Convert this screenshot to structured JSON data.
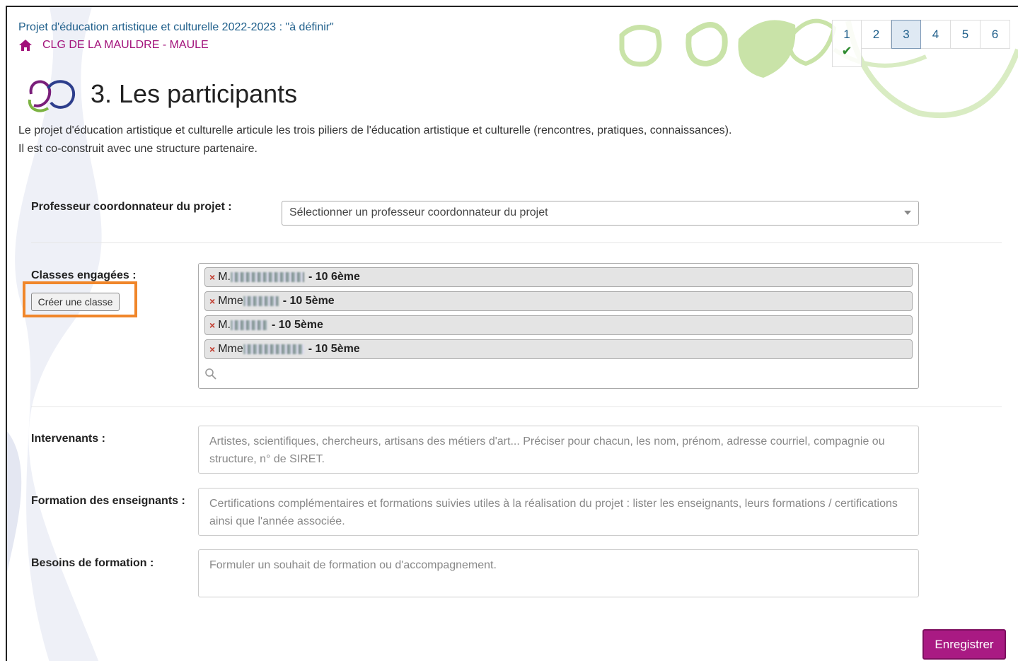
{
  "header": {
    "project_title": "Projet d'éducation artistique et culturelle 2022-2023 : \"à définir\"",
    "school": "CLG DE LA MAULDRE - MAULE"
  },
  "steps": [
    {
      "label": "1",
      "done": true
    },
    {
      "label": "2"
    },
    {
      "label": "3",
      "active": true
    },
    {
      "label": "4"
    },
    {
      "label": "5"
    },
    {
      "label": "6"
    }
  ],
  "page": {
    "title": "3. Les participants",
    "intro_line1": "Le projet d'éducation artistique et culturelle articule les trois piliers de l'éducation artistique et culturelle (rencontres, pratiques, connaissances).",
    "intro_line2": "Il est co-construit avec une structure partenaire."
  },
  "form": {
    "coordinator_label": "Professeur coordonnateur du projet :",
    "coordinator_placeholder": "Sélectionner un professeur coordonnateur du projet",
    "classes_label": "Classes engagées :",
    "create_class_label": "Créer une classe",
    "classes": [
      {
        "name": "M. ",
        "cls": "- 10 6ème"
      },
      {
        "name": "Mme ",
        "cls": "- 10 5ème"
      },
      {
        "name": "M. ",
        "cls": "- 10 5ème"
      },
      {
        "name": "Mme ",
        "cls": "- 10 5ème"
      }
    ],
    "intervenants_label": "Intervenants :",
    "intervenants_placeholder": "Artistes, scientifiques, chercheurs, artisans des métiers d'art... Préciser pour chacun, les nom, prénom, adresse courriel, compagnie ou structure, n° de SIRET.",
    "formation_label": "Formation des enseignants :",
    "formation_placeholder": "Certifications complémentaires et formations suivies utiles à la réalisation du projet : lister les enseignants, leurs formations / certifications ainsi que l'année associée.",
    "besoins_label": "Besoins de formation :",
    "besoins_placeholder": "Formuler un souhait de formation ou d'accompagnement.",
    "save_label": "Enregistrer"
  },
  "colors": {
    "accent": "#a91a83",
    "link": "#1f5f8b",
    "highlight": "#f0862a",
    "deco_green": "#c5e1a5"
  }
}
